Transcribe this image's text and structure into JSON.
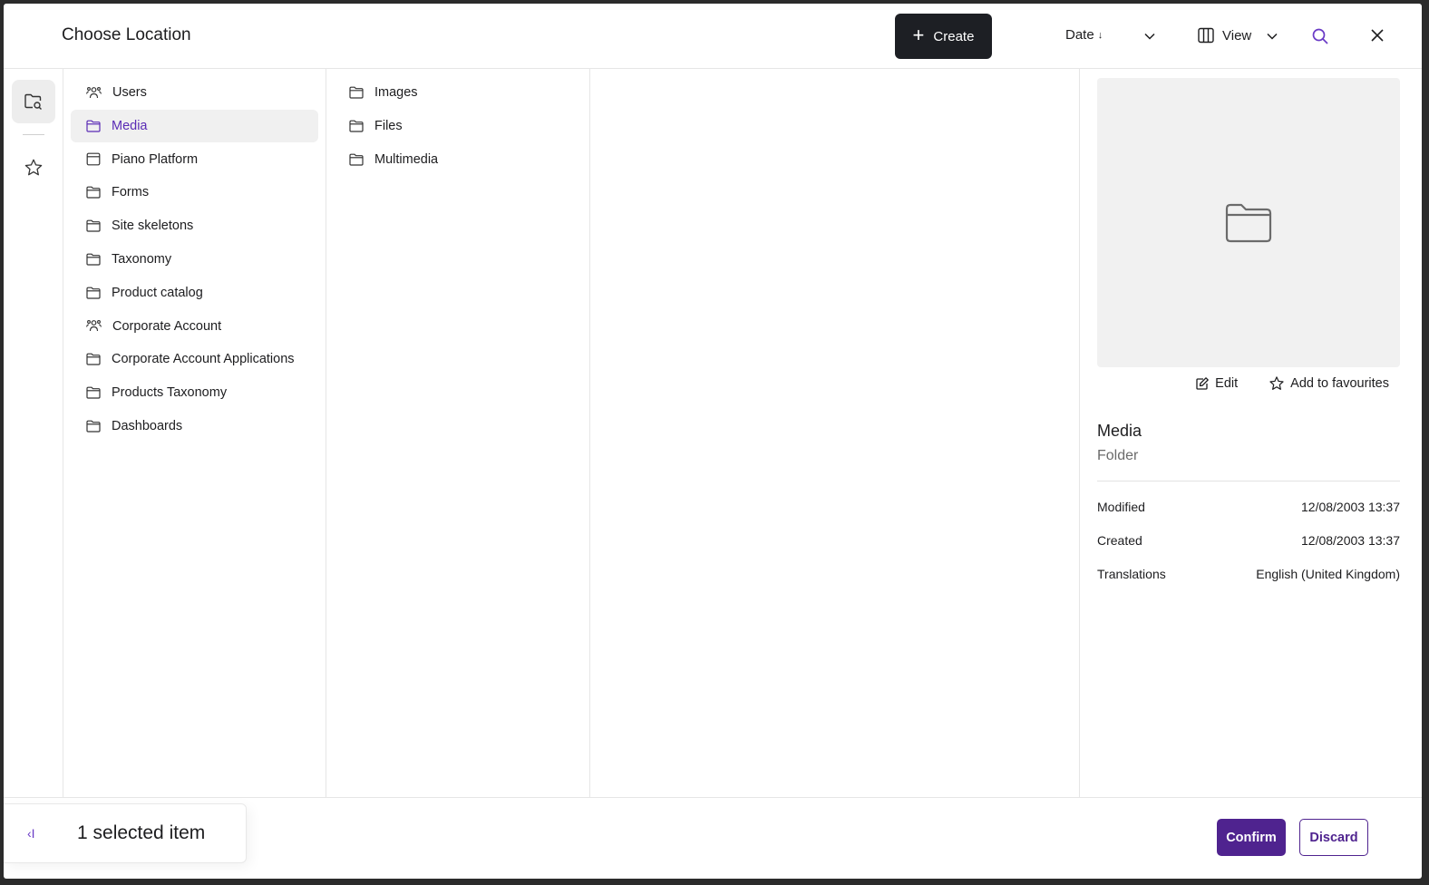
{
  "header": {
    "title": "Choose Location",
    "create_label": "Create",
    "sort_label": "Date",
    "sort_direction_icon": "↓",
    "view_label": "View"
  },
  "tree": {
    "column1": [
      {
        "label": "Users",
        "icon": "users-icon"
      },
      {
        "label": "Media",
        "icon": "folder-icon",
        "selected": true
      },
      {
        "label": "Piano Platform",
        "icon": "window-icon"
      },
      {
        "label": "Forms",
        "icon": "folder-icon"
      },
      {
        "label": "Site skeletons",
        "icon": "folder-icon"
      },
      {
        "label": "Taxonomy",
        "icon": "folder-icon"
      },
      {
        "label": "Product catalog",
        "icon": "folder-icon"
      },
      {
        "label": "Corporate Account",
        "icon": "users-icon"
      },
      {
        "label": "Corporate Account Applications",
        "icon": "folder-icon"
      },
      {
        "label": "Products Taxonomy",
        "icon": "folder-icon"
      },
      {
        "label": "Dashboards",
        "icon": "folder-icon"
      }
    ],
    "column2": [
      {
        "label": "Images",
        "icon": "folder-icon"
      },
      {
        "label": "Files",
        "icon": "folder-icon"
      },
      {
        "label": "Multimedia",
        "icon": "folder-icon"
      }
    ]
  },
  "details": {
    "edit_label": "Edit",
    "favourite_label": "Add to favourites",
    "name": "Media",
    "type": "Folder",
    "properties": [
      {
        "label": "Modified",
        "value": "12/08/2003 13:37"
      },
      {
        "label": "Created",
        "value": "12/08/2003 13:37"
      },
      {
        "label": "Translations",
        "value": "English (United Kingdom)"
      }
    ]
  },
  "footer": {
    "collapse_icon": "‹I",
    "selected_text": "1 selected item",
    "confirm_label": "Confirm",
    "discard_label": "Discard"
  },
  "colors": {
    "accent": "#4f238f",
    "selected_text": "#5a2bb5",
    "create_bg": "#1d1f24"
  }
}
